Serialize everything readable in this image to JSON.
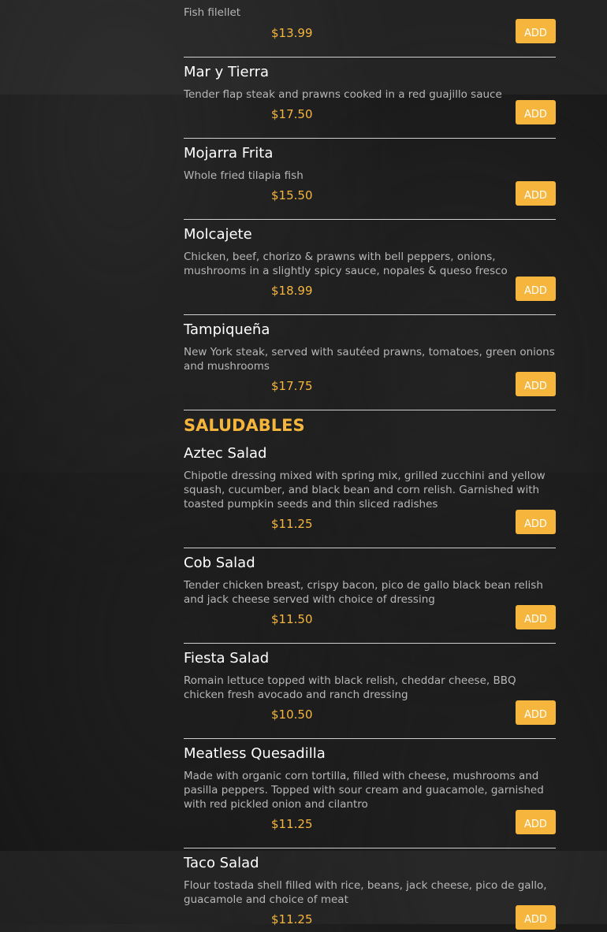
{
  "colors": {
    "accent": "#f6b63d",
    "text": "#ffffff",
    "muted": "#b7b7b7",
    "background": "#1b1b1b"
  },
  "sections": [
    {
      "title": "SALUDABLES"
    }
  ],
  "items": [
    {
      "name": "",
      "description": "Fish filellet",
      "price": "$13.99",
      "button": "ADD"
    },
    {
      "name": "Mar y Tierra",
      "description": "Tender flap steak and prawns cooked in a red guajillo sauce",
      "price": "$17.50",
      "button": "ADD"
    },
    {
      "name": "Mojarra Frita",
      "description": "Whole fried tilapia fish",
      "price": "$15.50",
      "button": "ADD"
    },
    {
      "name": "Molcajete",
      "description": "Chicken, beef, chorizo & prawns with bell peppers, onions, mushrooms in a slightly spicy sauce, nopales & queso fresco",
      "price": "$18.99",
      "button": "ADD"
    },
    {
      "name": "Tampiqueña",
      "description": "New York steak, served with sautéed prawns, tomatoes, green onions and mushrooms",
      "price": "$17.75",
      "button": "ADD"
    },
    {
      "name": "Aztec Salad",
      "description": "Chipotle dressing mixed with spring mix, grilled zucchini and yellow squash, cucumber, and black bean and corn relish. Garnished with toasted pumpkin seeds and thin sliced radishes",
      "price": "$11.25",
      "button": "ADD"
    },
    {
      "name": "Cob Salad",
      "description": "Tender chicken breast, crispy bacon, pico de gallo black bean relish and jack cheese served with choice of dressing",
      "price": "$11.50",
      "button": "ADD"
    },
    {
      "name": "Fiesta Salad",
      "description": "Romain lettuce topped with black relish, cheddar cheese, BBQ chicken fresh avocado and ranch dressing",
      "price": "$10.50",
      "button": "ADD"
    },
    {
      "name": "Meatless Quesadilla",
      "description": "Made with organic corn tortilla, filled with cheese, mushrooms and pasilla peppers. Topped with sour cream and guacamole, garnished with red pickled onion and cilantro",
      "price": "$11.25",
      "button": "ADD"
    },
    {
      "name": "Taco Salad",
      "description": "Flour tostada shell filled with rice, beans, jack cheese, pico de gallo, guacamole and choice of meat",
      "price": "$11.25",
      "button": "ADD"
    }
  ]
}
